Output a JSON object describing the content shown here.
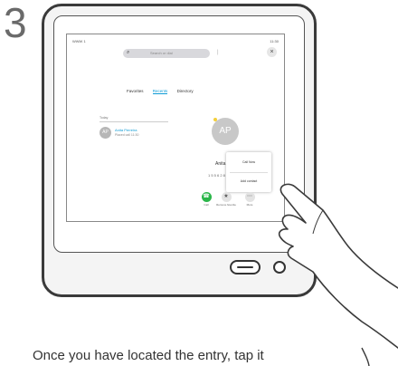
{
  "step": {
    "number": "3"
  },
  "status": {
    "left": "WWW 1",
    "right": "11:30"
  },
  "search": {
    "placeholder": "Search or dial",
    "icon": "search-icon"
  },
  "close": {
    "icon": "close-icon",
    "glyph": "×"
  },
  "tabs": [
    {
      "label": "Favorites",
      "active": false
    },
    {
      "label": "Recents",
      "active": true
    },
    {
      "label": "Directory",
      "active": false
    }
  ],
  "recents": {
    "section_label": "Today",
    "items": [
      {
        "initials": "AP",
        "name": "Anita Perreira",
        "sub": "Placed call 11:30"
      }
    ]
  },
  "contact": {
    "initials": "AP",
    "name": "Anita P",
    "number": "1 5 5 6 2 8 5"
  },
  "menu": {
    "options": [
      "Call Now",
      "Add contact"
    ]
  },
  "actions": [
    {
      "label": "Call",
      "icon": "phone-icon",
      "color": "#2bb64a"
    },
    {
      "label": "Remove favorite",
      "icon": "star-icon",
      "color": "#e3e3e3"
    },
    {
      "label": "More",
      "icon": "more-icon",
      "color": "#e3e3e3"
    }
  ],
  "colors": {
    "accent": "#0d9bd5",
    "call_green": "#2bb64a",
    "status_dot": "#f3cf3a"
  },
  "caption": "Once you have located the entry, tap it"
}
